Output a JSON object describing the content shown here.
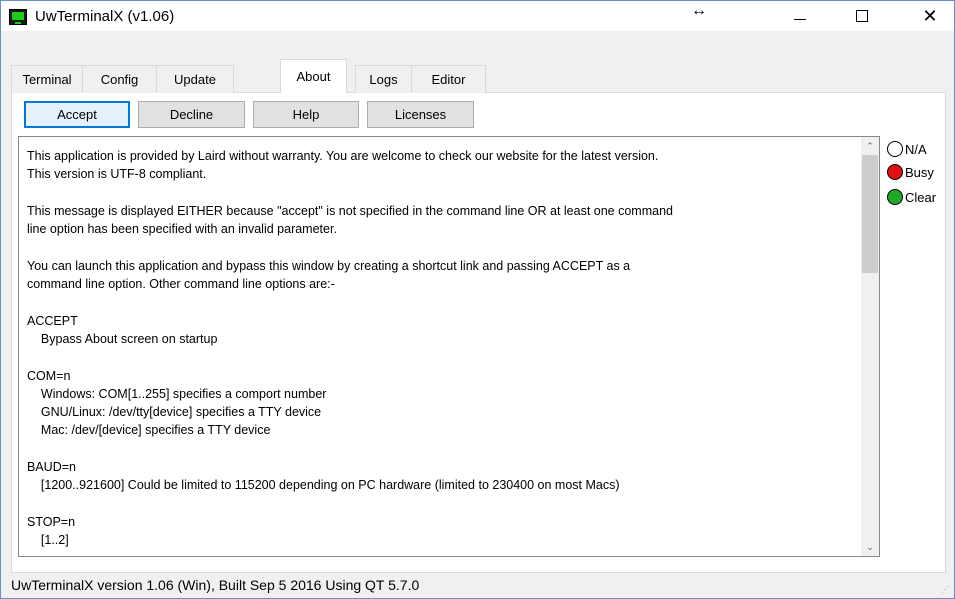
{
  "window": {
    "title": "UwTerminalX (v1.06)",
    "resize_glyph": "↔",
    "close_glyph": "✕"
  },
  "tabs": [
    {
      "label": "Terminal"
    },
    {
      "label": "Config"
    },
    {
      "label": "Update"
    },
    {
      "label": "About"
    },
    {
      "label": "Logs"
    },
    {
      "label": "Editor"
    }
  ],
  "active_tab": "About",
  "buttons": {
    "accept": "Accept",
    "decline": "Decline",
    "help": "Help",
    "licenses": "Licenses"
  },
  "about_text": "This application is provided by Laird without warranty. You are welcome to check our website for the latest version.\nThis version is UTF-8 compliant.\n\nThis message is displayed EITHER because \"accept\" is not specified in the command line OR at least one command\nline option has been specified with an invalid parameter.\n\nYou can launch this application and bypass this window by creating a shortcut link and passing ACCEPT as a\ncommand line option. Other command line options are:-\n\nACCEPT\n    Bypass About screen on startup\n\nCOM=n\n    Windows: COM[1..255] specifies a comport number\n    GNU/Linux: /dev/tty[device] specifies a TTY device\n    Mac: /dev/[device] specifies a TTY device\n\nBAUD=n\n    [1200..921600] Could be limited to 115200 depending on PC hardware (limited to 230400 on most Macs)\n\nSTOP=n\n    [1..2]",
  "status_indicators": {
    "na": {
      "label": "N/A",
      "color": "#ffffff"
    },
    "busy": {
      "label": "Busy",
      "color": "#e01010"
    },
    "clear": {
      "label": "Clear",
      "color": "#1fa82a"
    }
  },
  "statusbar": {
    "text": "UwTerminalX version 1.06 (Win), Built Sep  5 2016 Using QT 5.7.0"
  }
}
